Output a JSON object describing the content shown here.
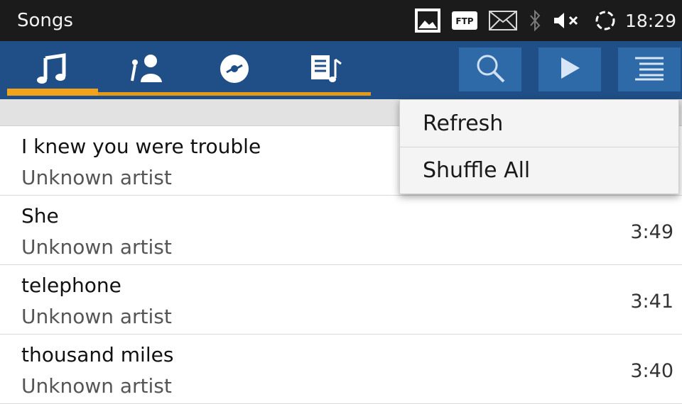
{
  "status_bar": {
    "title": "Songs",
    "time": "18:29",
    "icons": [
      "image-icon",
      "ftp-icon",
      "mail-icon",
      "bluetooth-icon",
      "mute-icon",
      "sync-icon"
    ],
    "ftp_label": "FTP"
  },
  "tabs": [
    {
      "icon": "music-note-icon",
      "selected": true
    },
    {
      "icon": "artist-icon",
      "selected": false
    },
    {
      "icon": "album-icon",
      "selected": false
    },
    {
      "icon": "playlist-icon",
      "selected": false
    }
  ],
  "actions": [
    "search-icon",
    "play-icon",
    "menu-icon"
  ],
  "menu": {
    "items": [
      {
        "label": "Refresh"
      },
      {
        "label": "Shuffle All"
      }
    ]
  },
  "songs": [
    {
      "title": "I knew you were trouble",
      "artist": "Unknown artist",
      "duration": ""
    },
    {
      "title": "She",
      "artist": "Unknown artist",
      "duration": "3:49"
    },
    {
      "title": "telephone",
      "artist": "Unknown artist",
      "duration": "3:41"
    },
    {
      "title": "thousand miles",
      "artist": "Unknown artist",
      "duration": "3:40"
    }
  ],
  "colors": {
    "status_bar": "#1b1b1b",
    "tab_bar": "#1f4f86",
    "action_button": "#2f6aa8",
    "tab_indicator": "#f3a21b"
  }
}
